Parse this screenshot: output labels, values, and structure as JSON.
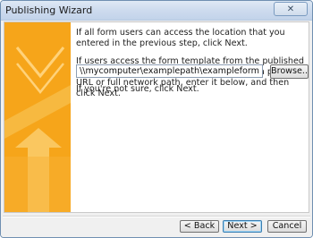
{
  "window": {
    "title": "Publishing Wizard",
    "close_glyph": "✕"
  },
  "content": {
    "paragraph1": "If all form users can access the location that you entered in the previous step, click Next.",
    "paragraph2": "If users access the form template from the published location by using a different path, such as a public URL or full network path, enter it below, and then click Next.",
    "path_value": "\\\\mycomputer\\examplepath\\exampleform.xsn",
    "browse_label": "Browse...",
    "hint": "If you're not sure, click Next."
  },
  "footer": {
    "back_label": "< Back",
    "next_label": "Next >",
    "cancel_label": "Cancel"
  },
  "colors": {
    "banner_orange": "#f39c16",
    "banner_light": "#f7b637"
  }
}
